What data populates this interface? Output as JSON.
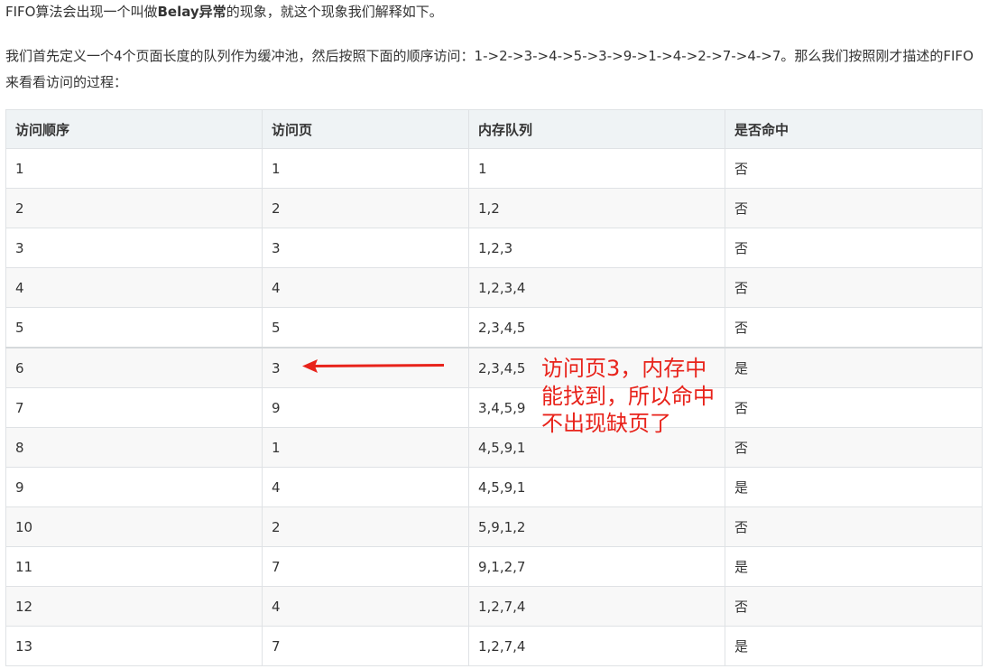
{
  "intro": {
    "prefix": "FIFO算法会出现一个叫做",
    "bold": "Belay异常",
    "suffix": "的现象，就这个现象我们解释如下。"
  },
  "paragraph": "我们首先定义一个4个页面长度的队列作为缓冲池，然后按照下面的顺序访问：1->2->3->4->5->3->9->1->4->2->7->4->7。那么我们按照刚才描述的FIFO来看看访问的过程：",
  "table": {
    "headers": [
      "访问顺序",
      "访问页",
      "内存队列",
      "是否命中"
    ],
    "rows": [
      [
        "1",
        "1",
        "1",
        "否"
      ],
      [
        "2",
        "2",
        "1,2",
        "否"
      ],
      [
        "3",
        "3",
        "1,2,3",
        "否"
      ],
      [
        "4",
        "4",
        "1,2,3,4",
        "否"
      ],
      [
        "5",
        "5",
        "2,3,4,5",
        "否"
      ],
      [
        "6",
        "3",
        "2,3,4,5",
        "是"
      ],
      [
        "7",
        "9",
        "3,4,5,9",
        "否"
      ],
      [
        "8",
        "1",
        "4,5,9,1",
        "否"
      ],
      [
        "9",
        "4",
        "4,5,9,1",
        "是"
      ],
      [
        "10",
        "2",
        "5,9,1,2",
        "否"
      ],
      [
        "11",
        "7",
        "9,1,2,7",
        "是"
      ],
      [
        "12",
        "4",
        "1,2,7,4",
        "否"
      ],
      [
        "13",
        "7",
        "1,2,7,4",
        "是"
      ]
    ]
  },
  "annotation": {
    "lines": [
      "访问页3，内存中",
      "能找到，所以命中",
      "不出现缺页了"
    ],
    "color": "#e8231b"
  }
}
